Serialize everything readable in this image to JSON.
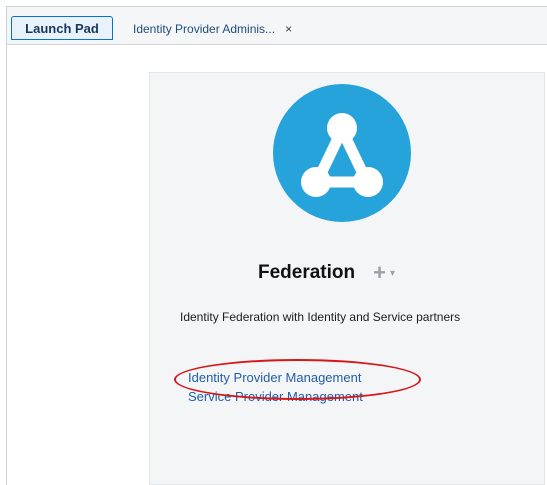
{
  "tabs": {
    "launch_pad": "Launch Pad",
    "identity_provider": "Identity Provider Adminis...",
    "close_glyph": "×"
  },
  "card": {
    "icon": "federation-triangle-icon",
    "icon_color": "#27a3db",
    "title": "Federation",
    "add_glyph": "+",
    "menu_glyph": "▾",
    "description": "Identity Federation with Identity and Service partners",
    "links": [
      "Identity Provider Management",
      "Service Provider Management"
    ]
  },
  "annotation": {
    "highlight_color": "#d6161b"
  }
}
